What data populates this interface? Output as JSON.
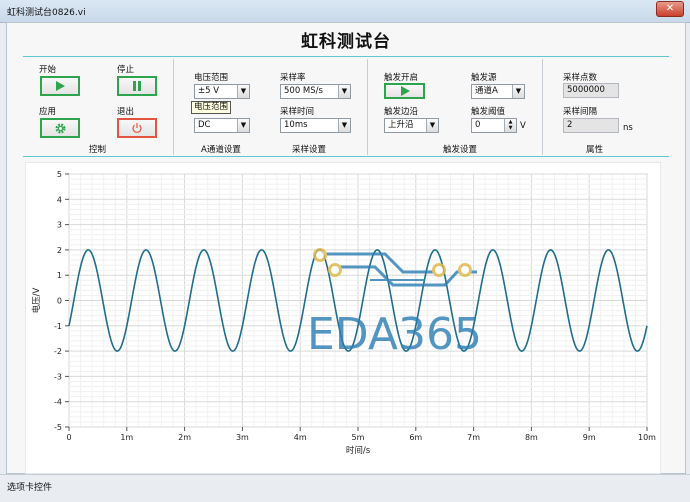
{
  "window": {
    "title": "虹科测试台0826.vi",
    "close_symbol": "✕"
  },
  "app": {
    "title": "虹科测试台"
  },
  "control": {
    "start_label": "开始",
    "stop_label": "停止",
    "apply_label": "应用",
    "exit_label": "退出",
    "section_label": "控制"
  },
  "channel": {
    "range_label": "电压范围",
    "range_value": "±5 V",
    "range_tooltip": "电压范围",
    "coupling_value": "DC",
    "section_label": "A通道设置"
  },
  "sampling": {
    "rate_label": "采样率",
    "rate_value": "500 MS/s",
    "time_label": "采样时间",
    "time_value": "10ms",
    "section_label": "采样设置"
  },
  "trigger": {
    "enable_label": "触发开启",
    "source_label": "触发源",
    "source_value": "通道A",
    "edge_label": "触发边沿",
    "edge_value": "上升沿",
    "threshold_label": "触发阈值",
    "threshold_value": "0",
    "threshold_unit": "V",
    "section_label": "触发设置"
  },
  "properties": {
    "points_label": "采样点数",
    "points_value": "5000000",
    "interval_label": "采样间隔",
    "interval_value": "2",
    "interval_unit": "ns",
    "section_label": "属性"
  },
  "watermark": {
    "text": "EDA365"
  },
  "status": {
    "text": "选项卡控件"
  },
  "icons": {
    "start": "play-icon",
    "stop": "pause-icon",
    "apply": "gear-icon",
    "exit": "power-icon"
  },
  "colors": {
    "trace": "#1f6e8c",
    "accent_line": "#5ec7cf",
    "button_green": "#2ea44f",
    "button_red": "#e4553f"
  },
  "chart_data": {
    "type": "line",
    "xlabel": "时间/s",
    "ylabel": "电压/V",
    "xlim": [
      0,
      0.01
    ],
    "ylim": [
      -5,
      5
    ],
    "xticks": [
      "0",
      "1m",
      "2m",
      "3m",
      "4m",
      "5m",
      "6m",
      "7m",
      "8m",
      "9m",
      "10m"
    ],
    "yticks": [
      "-5",
      "-4",
      "-3",
      "-2",
      "-1",
      "0",
      "1",
      "2",
      "3",
      "4",
      "5"
    ],
    "grid": true,
    "series": [
      {
        "waveform": "sine",
        "amplitude": 2,
        "offset": 0,
        "frequency_hz": 1000,
        "start_value": -1
      }
    ]
  }
}
